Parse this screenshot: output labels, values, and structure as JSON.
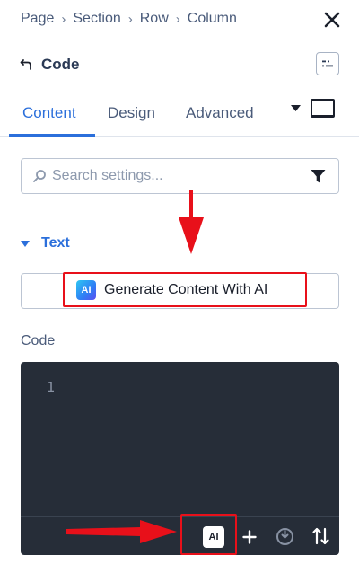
{
  "breadcrumb": {
    "items": [
      "Page",
      "Section",
      "Row",
      "Column"
    ]
  },
  "module": {
    "title": "Code"
  },
  "tabs": [
    {
      "label": "Content",
      "active": true
    },
    {
      "label": "Design",
      "active": false
    },
    {
      "label": "Advanced",
      "active": false
    }
  ],
  "search": {
    "placeholder": "Search settings..."
  },
  "section": {
    "label": "Text"
  },
  "ai_button": {
    "badge": "AI",
    "label": "Generate Content With AI"
  },
  "code_field": {
    "label": "Code",
    "line_numbers": [
      "1"
    ]
  },
  "editor_toolbar": {
    "ai_label": "AI"
  },
  "colors": {
    "accent": "#2b6fdb",
    "highlight": "#e8101a",
    "editor_bg": "#262d38"
  }
}
